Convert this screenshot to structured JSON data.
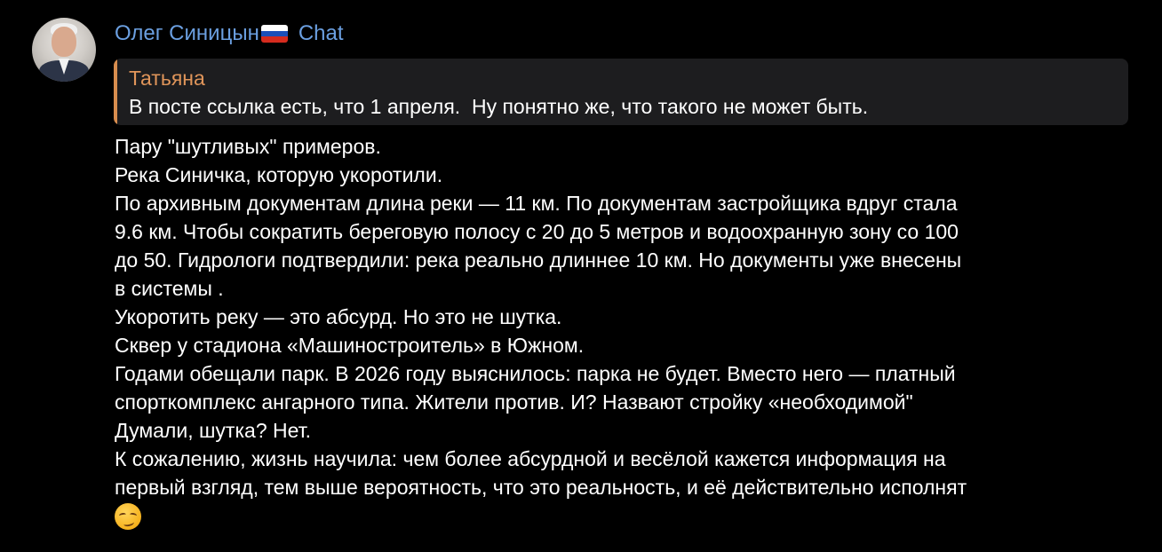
{
  "sender": {
    "name": "Олег Синицын",
    "flag_colors": [
      "#ffffff",
      "#1b4fb8",
      "#d52b1e"
    ],
    "chat_label": "Chat",
    "avatar_icon": "user-avatar"
  },
  "reply": {
    "author": "Татьяна",
    "text": "В посте ссылка есть, что 1 апреля.  Ну понятно же, что такого не может быть.",
    "accent_color": "#d88d4e"
  },
  "message": {
    "lines": [
      "Пару \"шутливых\" примеров.",
      "Река Синичка, которую укоротили.",
      "По архивным документам длина реки — 11 км. По документам застройщика вдруг стала",
      "9.6 км. Чтобы сократить береговую полосу с 20 до 5 метров и водоохранную зону со 100",
      "до 50. Гидрологи подтвердили: река реально длиннее 10 км. Но документы уже внесены",
      "в системы .",
      "Укоротить реку — это абсурд. Но это не шутка.",
      "Сквер у стадиона «Машиностроитель» в Южном.",
      "Годами обещали парк. В 2026 году выяснилось: парка не будет. Вместо него — платный",
      "спорткомплекс ангарного типа. Жители против. И? Назвают стройку «необходимой\"",
      "Думали, шутка? Нет.",
      "К сожалению, жизнь научила: чем более абсурдной и весёлой кажется информация на",
      "первый взгляд, тем выше вероятность, что это реальность, и её действительно исполнят"
    ],
    "trailing_emoji": "smirking-face-emoji"
  },
  "colors": {
    "background": "#000000",
    "name_color": "#6b9fe0",
    "reply_bg": "#1d1d1f",
    "reply_author": "#e0955a"
  }
}
